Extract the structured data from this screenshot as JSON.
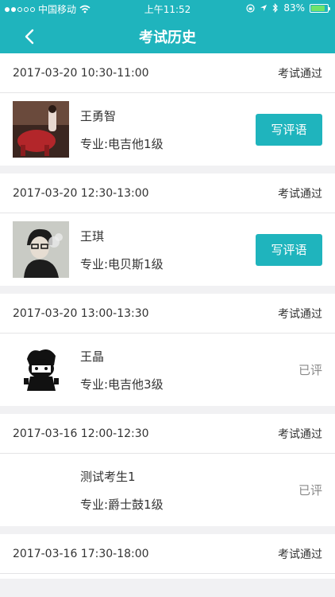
{
  "status_bar": {
    "carrier": "中国移动",
    "time": "上午11:52",
    "battery": "83%"
  },
  "nav": {
    "title": "考试历史"
  },
  "records": [
    {
      "datetime": "2017-03-20 10:30-11:00",
      "status": "考试通过",
      "name": "王勇智",
      "major": "专业:电吉他1级",
      "action": "写评语",
      "action_type": "button"
    },
    {
      "datetime": "2017-03-20 12:30-13:00",
      "status": "考试通过",
      "name": "王琪",
      "major": "专业:电贝斯1级",
      "action": "写评语",
      "action_type": "button"
    },
    {
      "datetime": "2017-03-20 13:00-13:30",
      "status": "考试通过",
      "name": "王晶",
      "major": "专业:电吉他3级",
      "action": "已评",
      "action_type": "text"
    },
    {
      "datetime": "2017-03-16 12:00-12:30",
      "status": "考试通过",
      "name": "测试考生1",
      "major": "专业:爵士鼓1级",
      "action": "已评",
      "action_type": "text"
    },
    {
      "datetime": "2017-03-16 17:30-18:00",
      "status": "考试通过"
    }
  ],
  "colors": {
    "accent": "#1fb4bd",
    "background": "#f1f1f3",
    "muted": "#8a8a8a"
  }
}
